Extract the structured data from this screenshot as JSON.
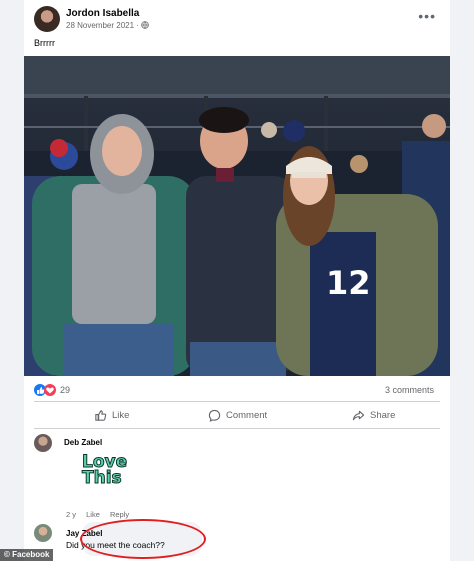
{
  "post": {
    "author": "Jordon Isabella",
    "date": "28 November 2021 · ",
    "privacy_icon": "globe-icon",
    "caption": "Brrrrr",
    "more_label": "•••"
  },
  "reactions": {
    "icons": [
      "like-icon",
      "love-icon"
    ],
    "count": "29",
    "comments": "3 comments",
    "colors": {
      "like": "#1877f2",
      "love": "#f33e58"
    }
  },
  "actions": {
    "like": "Like",
    "comment": "Comment",
    "share": "Share"
  },
  "comments": [
    {
      "author": "Deb Zabel",
      "sticker_line1": "Love",
      "sticker_line2": "This",
      "meta_time": "2 y",
      "meta_like": "Like",
      "meta_reply": "Reply"
    },
    {
      "author": "Jay Zabel",
      "text": "Did you meet the coach??"
    }
  ],
  "watermark": "© Facebook"
}
